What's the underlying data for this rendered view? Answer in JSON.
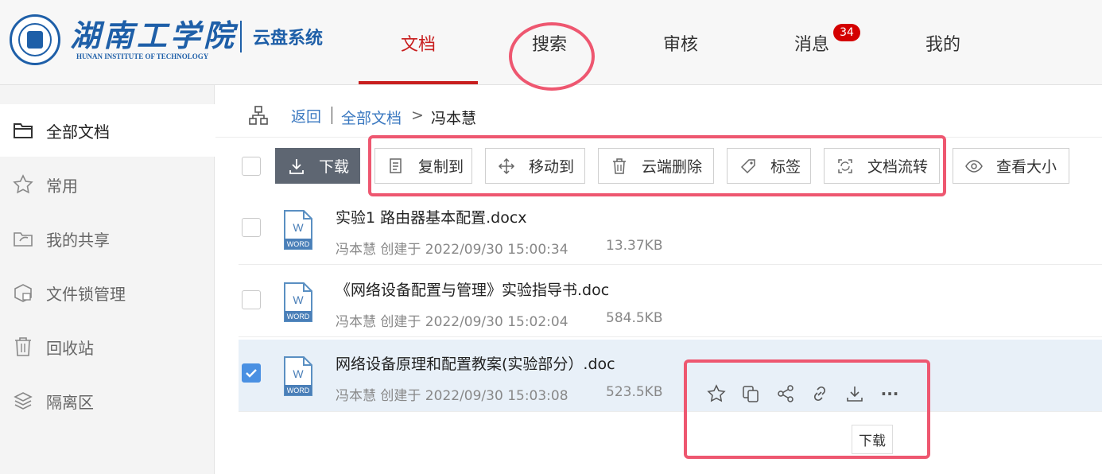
{
  "header": {
    "logo_cn": "湖南工学院",
    "logo_en": "HUNAN INSTITUTE OF TECHNOLOGY",
    "system_name": "云盘系统",
    "tabs": [
      {
        "label": "文档",
        "active": true
      },
      {
        "label": "搜索",
        "active": false
      },
      {
        "label": "审核",
        "active": false
      },
      {
        "label": "消息",
        "active": false,
        "badge": "34"
      },
      {
        "label": "我的",
        "active": false
      }
    ]
  },
  "sidebar": {
    "items": [
      {
        "label": "全部文档",
        "icon": "folder-icon",
        "active": true
      },
      {
        "label": "常用",
        "icon": "star-icon",
        "active": false
      },
      {
        "label": "我的共享",
        "icon": "share-folder-icon",
        "active": false
      },
      {
        "label": "文件锁管理",
        "icon": "lock-box-icon",
        "active": false
      },
      {
        "label": "回收站",
        "icon": "trash-icon",
        "active": false
      },
      {
        "label": "隔离区",
        "icon": "layers-icon",
        "active": false
      }
    ]
  },
  "breadcrumb": {
    "back": "返回",
    "all": "全部文档",
    "separator": ">",
    "current": "冯本慧"
  },
  "toolbar": {
    "download": "下载",
    "copy_to": "复制到",
    "move_to": "移动到",
    "cloud_delete": "云端删除",
    "tag": "标签",
    "doc_flow": "文档流转",
    "view_size": "查看大小"
  },
  "files": [
    {
      "name": "实验1 路由器基本配置.docx",
      "meta": "冯本慧 创建于 2022/09/30 15:00:34",
      "size": "13.37KB",
      "selected": false,
      "type_label": "WORD",
      "type_letter": "W"
    },
    {
      "name": "《网络设备配置与管理》实验指导书.doc",
      "meta": "冯本慧 创建于 2022/09/30 15:02:04",
      "size": "584.5KB",
      "selected": false,
      "type_label": "WORD",
      "type_letter": "W"
    },
    {
      "name": "网络设备原理和配置教案(实验部分）.doc",
      "meta": "冯本慧 创建于 2022/09/30 15:03:08",
      "size": "523.5KB",
      "selected": true,
      "type_label": "WORD",
      "type_letter": "W"
    }
  ],
  "row_actions": {
    "icons": [
      "star-icon",
      "copy-icon",
      "share-icon",
      "link-icon",
      "download-icon",
      "more-icon"
    ],
    "more_glyph": "···",
    "tooltip": "下载"
  },
  "colors": {
    "accent_red": "#c81e1e",
    "logo_blue": "#1e5fa8",
    "link_blue": "#3a78c0",
    "highlight": "#ee5770",
    "selected_row": "#e8f0f8"
  }
}
